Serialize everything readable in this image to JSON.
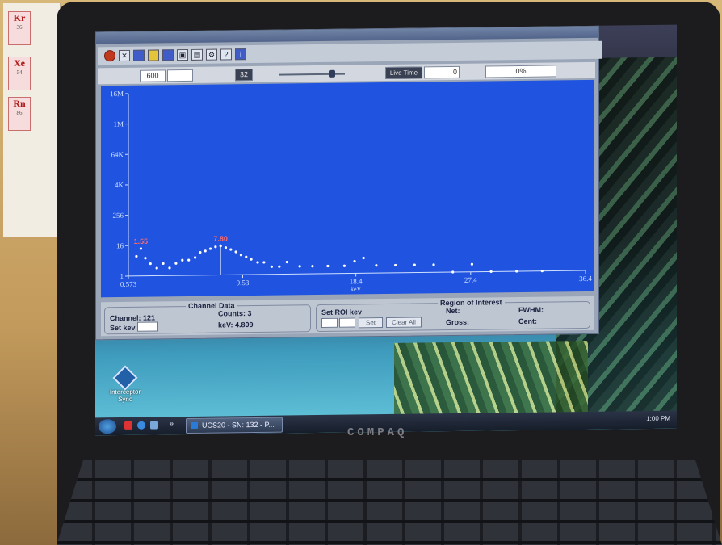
{
  "poster": {
    "elements": [
      {
        "symbol": "Kr",
        "number": "36"
      },
      {
        "symbol": "Xe",
        "number": "54"
      },
      {
        "symbol": "Rn",
        "number": "86"
      }
    ]
  },
  "app": {
    "toolbar": {
      "roi_field": "600",
      "range_button": "32",
      "live_time_label": "Live Time",
      "live_time_value": "0",
      "progress_label": "0%"
    },
    "chart_data": {
      "type": "scatter",
      "title": "",
      "xlabel": "keV",
      "ylabel": "",
      "x_ticks": [
        "0.573",
        "9.53",
        "18.4",
        "27.4",
        "36.4"
      ],
      "xlim": [
        0.573,
        36.4
      ],
      "y_ticks": [
        "16M",
        "1M",
        "64K",
        "4K",
        "256",
        "16",
        "1"
      ],
      "y_scale": "log",
      "grid": false,
      "annotations": [
        {
          "label": "1.55",
          "x": 1.55
        },
        {
          "label": "7.80",
          "x": 7.8
        }
      ],
      "series": [
        {
          "x": [
            1.2,
            1.55,
            1.9,
            2.3,
            2.8,
            3.3,
            3.8,
            4.3,
            4.8,
            5.3,
            5.8,
            6.2,
            6.6,
            7.0,
            7.4,
            7.8,
            8.2,
            8.6,
            9.0,
            9.4,
            9.8,
            10.2,
            10.7,
            11.2,
            11.8,
            12.4,
            13.0,
            14.0,
            15.0,
            16.2,
            17.5,
            18.3,
            19.0,
            20.0,
            21.5,
            23.0,
            24.5,
            26.0,
            27.5,
            29.0,
            31.0,
            33.0
          ],
          "y": [
            6,
            12,
            5,
            3,
            2,
            3,
            2,
            3,
            4,
            4,
            5,
            8,
            9,
            11,
            13,
            14,
            12,
            10,
            8,
            6,
            5,
            4,
            3,
            3,
            2,
            2,
            3,
            2,
            2,
            2,
            2,
            3,
            4,
            2,
            2,
            2,
            2,
            1,
            2,
            1,
            1,
            1
          ]
        }
      ]
    },
    "channel_data": {
      "legend": "Channel Data",
      "channel_label": "Channel: 121",
      "counts_label": "Counts: 3",
      "kev_label": "keV: 4.809",
      "set_kev_label": "Set kev"
    },
    "roi": {
      "legend": "Region of Interest",
      "set_roi_label": "Set ROI kev",
      "set_button": "Set",
      "clear_all_button": "Clear All",
      "net_label": "Net:",
      "gross_label": "Gross:",
      "fwhm_label": "FWHM:",
      "cent_label": "Cent:"
    }
  },
  "desktop": {
    "icon_label": "Interceptor Sync"
  },
  "taskbar": {
    "task_label": "UCS20 - SN: 132 - P...",
    "clock": "1:00 PM"
  },
  "laptop": {
    "brand": "COMPAQ"
  },
  "colors": {
    "plot_background": "#1f53e0",
    "points": "#ffffff",
    "peak_labels": "#ff6b6b",
    "axis": "#cfe0ff"
  }
}
